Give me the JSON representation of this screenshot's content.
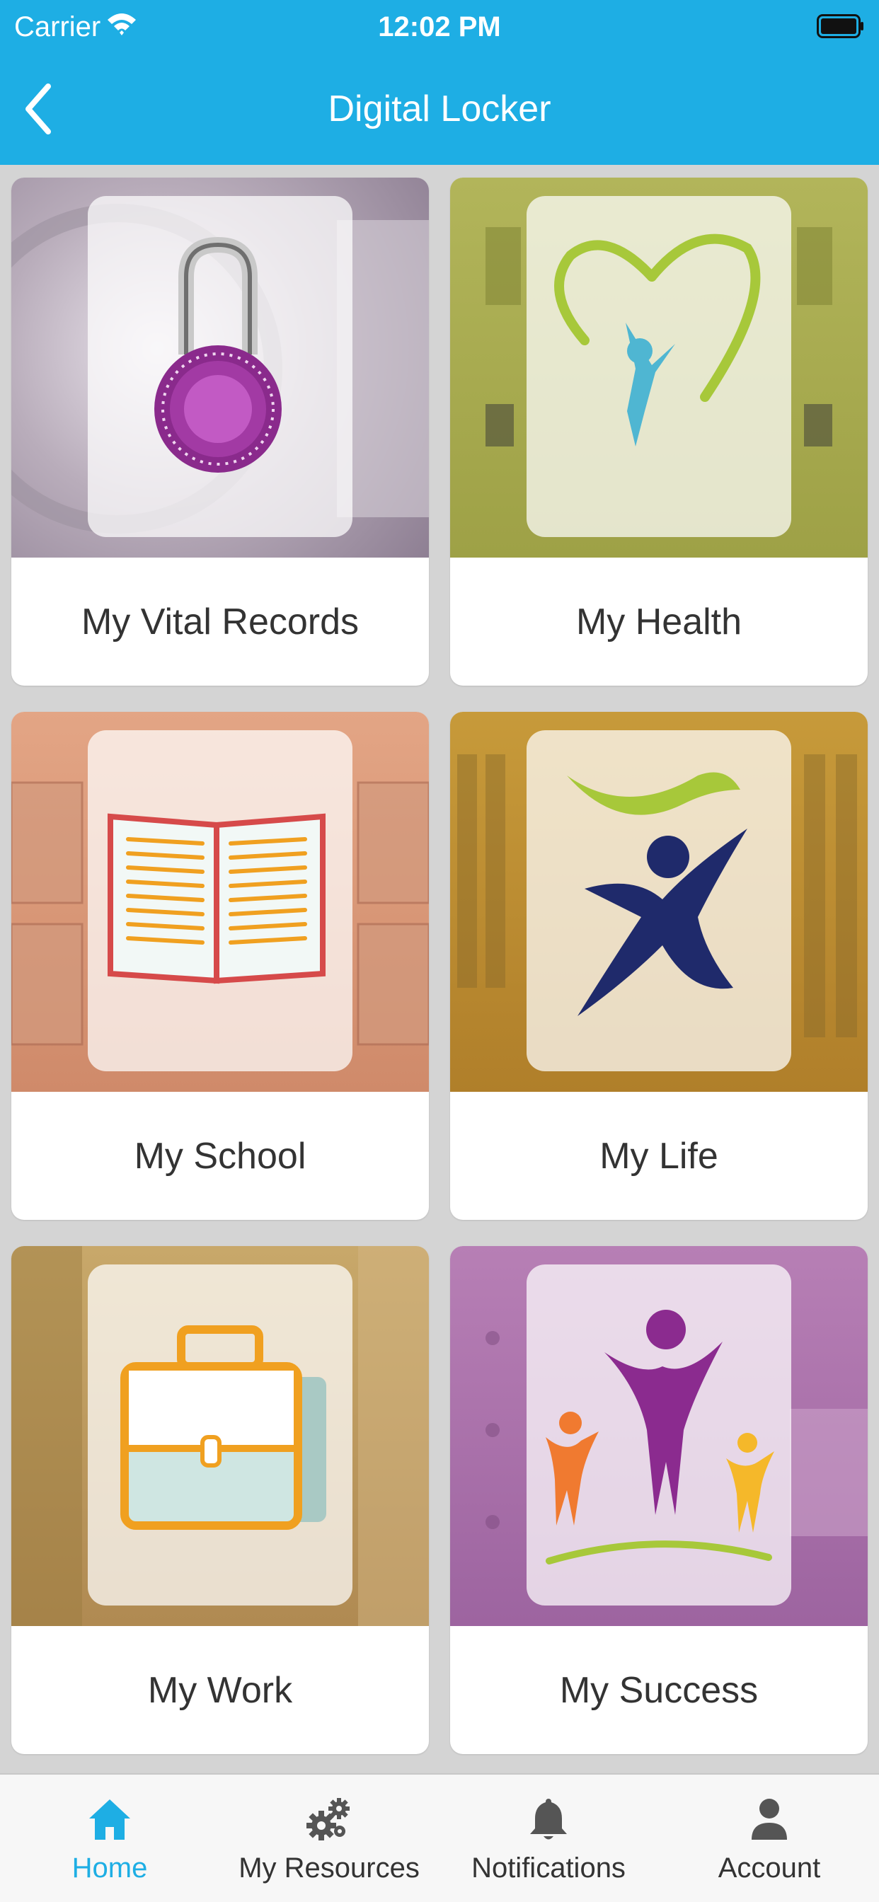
{
  "status_bar": {
    "carrier": "Carrier",
    "time": "12:02 PM"
  },
  "nav": {
    "title": "Digital Locker",
    "back_icon": "chevron-left-icon"
  },
  "colors": {
    "header": "#1eaee4",
    "tab_active": "#1eaee4",
    "tab_inactive": "#333333"
  },
  "cards": [
    {
      "label": "My Vital Records",
      "icon": "padlock-icon"
    },
    {
      "label": "My Health",
      "icon": "heart-person-icon"
    },
    {
      "label": "My School",
      "icon": "open-book-icon"
    },
    {
      "label": "My Life",
      "icon": "running-person-icon"
    },
    {
      "label": "My Work",
      "icon": "briefcase-icon"
    },
    {
      "label": "My Success",
      "icon": "celebrating-people-icon"
    }
  ],
  "tabs": [
    {
      "label": "Home",
      "icon": "home-icon",
      "active": true
    },
    {
      "label": "My Resources",
      "icon": "gears-icon",
      "active": false
    },
    {
      "label": "Notifications",
      "icon": "bell-icon",
      "active": false
    },
    {
      "label": "Account",
      "icon": "person-icon",
      "active": false
    }
  ]
}
